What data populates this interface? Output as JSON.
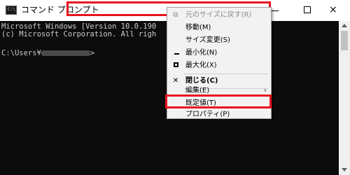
{
  "window": {
    "title": "コマンド プロンプト",
    "app_icon_text": "C:\\_",
    "controls": {
      "minimize": "minimize-icon",
      "maximize": "maximize-icon",
      "close": "×"
    }
  },
  "console": {
    "lines": [
      "Microsoft Windows [Version 10.0.190",
      "(c) Microsoft Corporation. All righ",
      "C:\\Users¥"
    ],
    "prompt_suffix": ">"
  },
  "context_menu": {
    "items": [
      {
        "glyph": "⧉",
        "label": "元のサイズに戻す(R)",
        "disabled": true
      },
      {
        "glyph": "",
        "label": "移動(M)",
        "disabled": false
      },
      {
        "glyph": "",
        "label": "サイズ変更(S)",
        "disabled": false
      },
      {
        "glyph": "",
        "label": "最小化(N)",
        "disabled": false
      },
      {
        "glyph": "",
        "label": "最大化(X)",
        "disabled": false
      },
      {
        "glyph": "✕",
        "label": "閉じる(C)",
        "bold": true
      },
      {
        "glyph": "",
        "label": "編集(E)",
        "submenu": "›"
      },
      {
        "glyph": "",
        "label": "既定値(T)"
      },
      {
        "glyph": "",
        "label": "プロパティ(P)"
      }
    ]
  },
  "highlight_color": "#e8121e"
}
